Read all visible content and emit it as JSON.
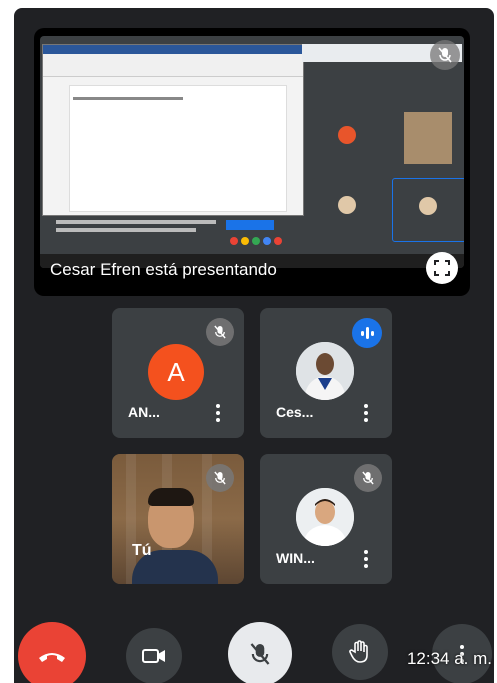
{
  "presentation": {
    "presenter_label": "Cesar Efren está presentando"
  },
  "participants": [
    {
      "name": "AN...",
      "avatar_letter": "A",
      "avatar_color": "#f4511e",
      "status": "muted"
    },
    {
      "name": "Ces...",
      "status": "speaking"
    },
    {
      "name": "Tú",
      "status": "muted"
    },
    {
      "name": "WIN...",
      "status": "muted"
    }
  ],
  "status_bar": {
    "time": "12:34 a. m."
  },
  "icons": {
    "end_call": "phone-hangup-icon",
    "camera": "videocam-icon",
    "mic": "mic-off-icon",
    "raise_hand": "hand-icon",
    "more": "more-vertical-icon",
    "fullscreen": "fullscreen-icon"
  },
  "colors": {
    "background": "#202124",
    "tile": "#3c4043",
    "end_call": "#ea4335",
    "speaking": "#1a73e8"
  }
}
